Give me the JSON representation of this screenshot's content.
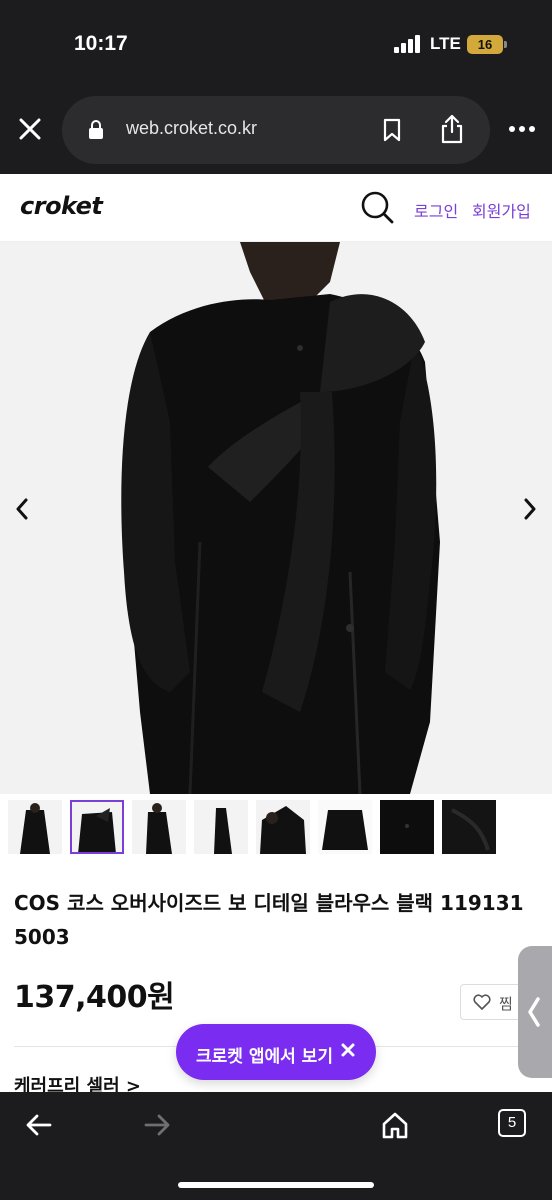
{
  "status_bar": {
    "time": "10:17",
    "network": "LTE",
    "battery": "16"
  },
  "browser": {
    "url": "web.croket.co.kr",
    "tab_count": "5"
  },
  "header": {
    "logo": "croket",
    "login": "로그인",
    "signup": "회원가입"
  },
  "product": {
    "title": "COS 코스 오버사이즈드 보 디테일 블라우스 블랙 119131 5003",
    "price": "137,400원",
    "like_label": "찜",
    "seller_link": "케러프리 셀러 >",
    "thumbnail_count": 8,
    "selected_thumbnail": 2
  },
  "cta": {
    "label": "크로켓 앱에서 보기"
  },
  "colors": {
    "accent": "#7a2cf0",
    "link": "#7a3fd6",
    "browser_chrome": "#1c1c1e"
  }
}
